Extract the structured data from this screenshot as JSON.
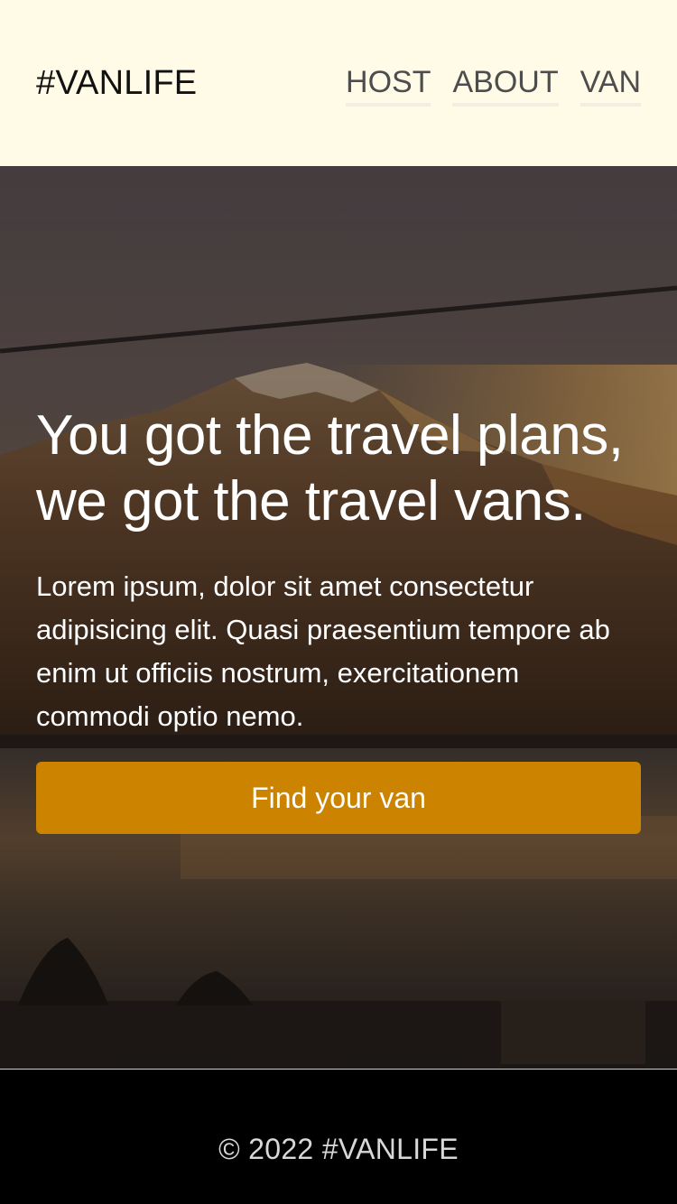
{
  "header": {
    "logo": "#VANLIFE",
    "nav": [
      {
        "label": "HOST"
      },
      {
        "label": "ABOUT"
      },
      {
        "label": "VAN"
      }
    ]
  },
  "hero": {
    "title_line1": "You got the travel plans,",
    "title_line2": "we got the travel vans.",
    "text": "Lorem ipsum, dolor sit amet consectetur adipisicing elit. Quasi praesentium tempore ab enim ut officiis nostrum, exercitationem commodi optio nemo.",
    "cta_label": "Find your van",
    "background_image": "mountain-lake-sunset"
  },
  "footer": {
    "text": "© 2022 #VANLIFE"
  },
  "colors": {
    "header_bg": "#fffbe6",
    "accent": "#cc8400",
    "footer_bg": "#000000"
  }
}
